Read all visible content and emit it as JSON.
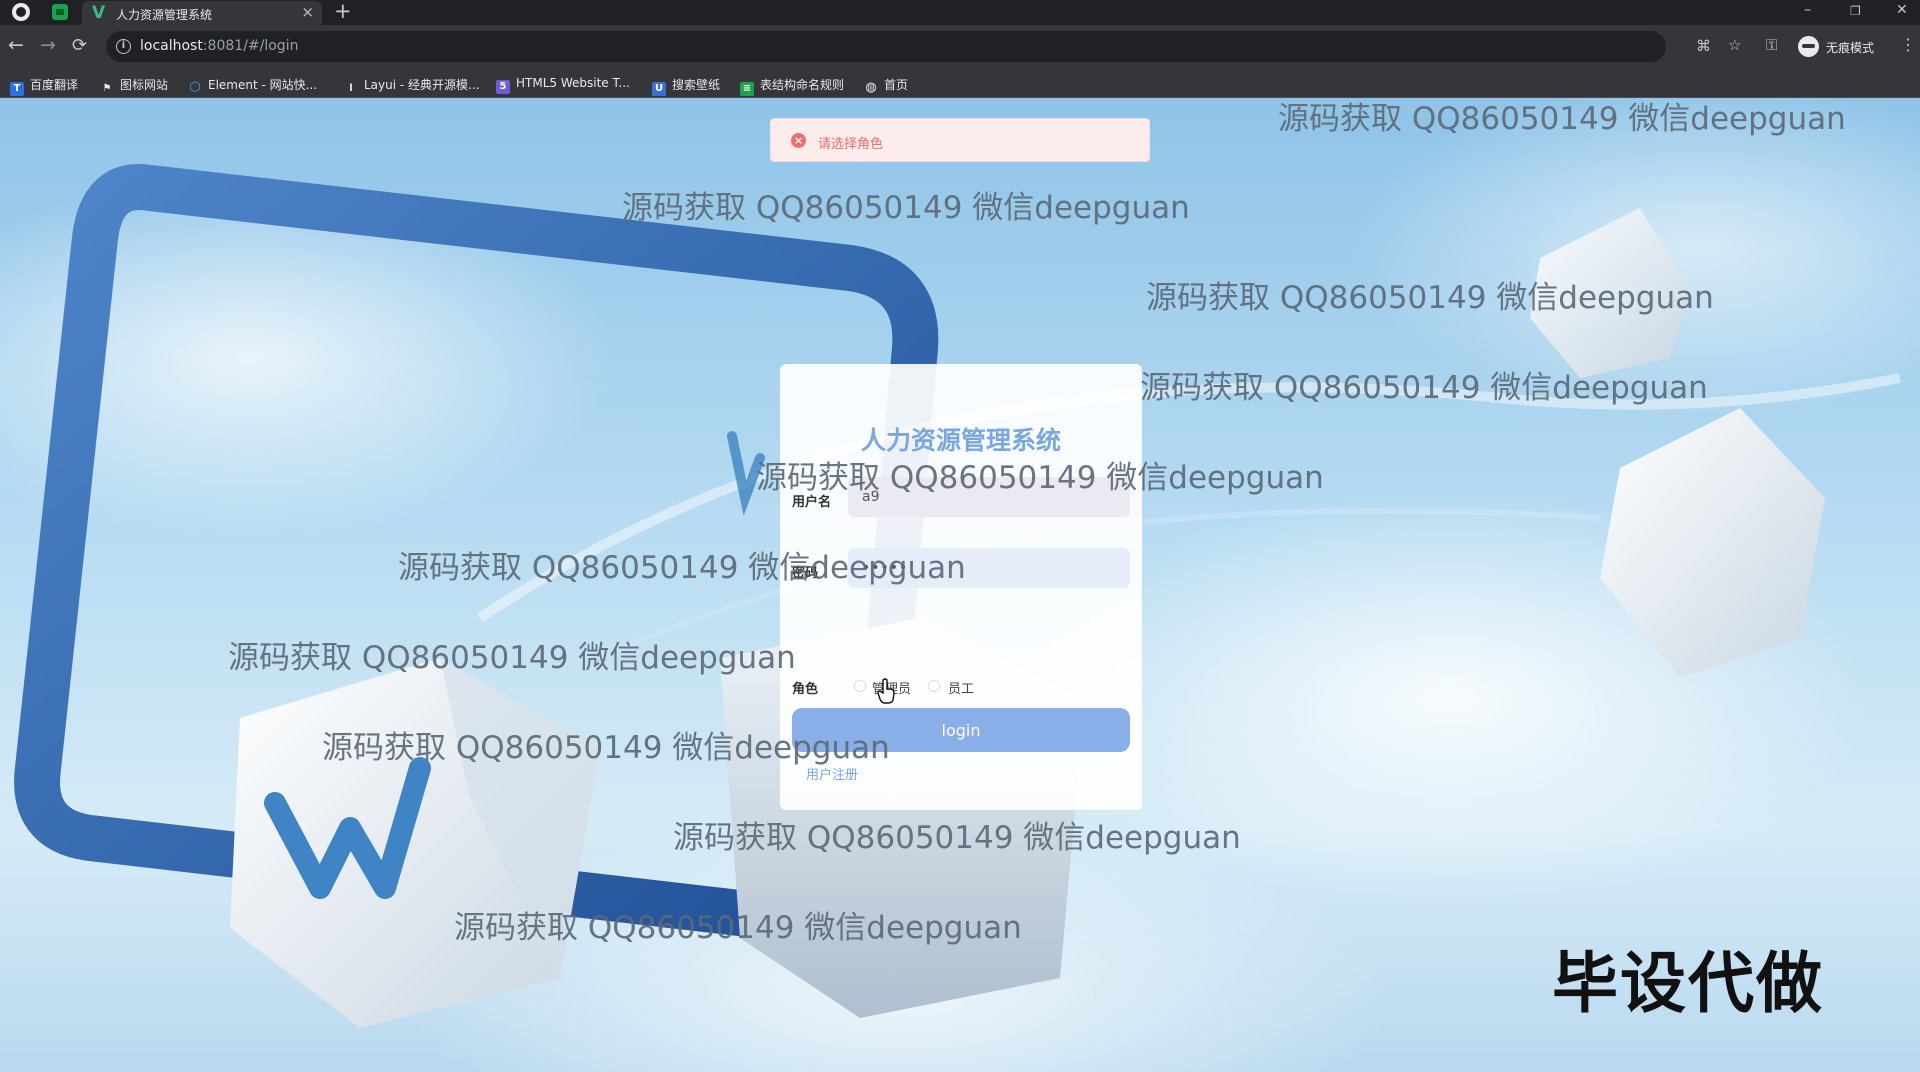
{
  "browser": {
    "tab": {
      "title": "人力资源管理系统",
      "close": "×"
    },
    "new_tab": "+",
    "window": {
      "minimize": "–",
      "restore": "❐",
      "close": "✕"
    },
    "nav": {
      "back": "←",
      "forward": "→",
      "reload": "⟳"
    },
    "url": {
      "host": "localhost",
      "path": ":8081/#/login"
    },
    "incognito_label": "无痕模式",
    "bookmarks": [
      {
        "label": "百度翻译",
        "icon": "baidu-translate-icon",
        "color": "#2f6fe4"
      },
      {
        "label": "图标网站",
        "icon": "flag-icon",
        "color": "#e8eaed"
      },
      {
        "label": "Element - 网站快...",
        "icon": "element-icon",
        "color": "#409eff"
      },
      {
        "label": "Layui - 经典开源模...",
        "icon": "layui-icon",
        "color": "#e8eaed"
      },
      {
        "label": "HTML5 Website T...",
        "icon": "html5-template-icon",
        "color": "#6f5bd6"
      },
      {
        "label": "搜索壁纸",
        "icon": "wallpaper-search-icon",
        "color": "#3b6fd8"
      },
      {
        "label": "表结构命名规则",
        "icon": "sheet-icon",
        "color": "#1aa34a"
      },
      {
        "label": "首页",
        "icon": "globe-icon",
        "color": "#e8eaed"
      }
    ]
  },
  "toast": {
    "message": "请选择角色",
    "type": "error",
    "color": "#f56c6c"
  },
  "login": {
    "title": "人力资源管理系统",
    "username_label": "用户名",
    "username_value": "a9",
    "password_label": "密码",
    "password_value": "•••••",
    "role_label": "角色",
    "roles": [
      "管理员",
      "员工"
    ],
    "button_label": "login",
    "register_link": "用户注册",
    "accent_color": "#8aaee8"
  },
  "watermark": {
    "text": "源码获取 QQ86050149 微信deepguan",
    "stamp": "毕设代做"
  }
}
